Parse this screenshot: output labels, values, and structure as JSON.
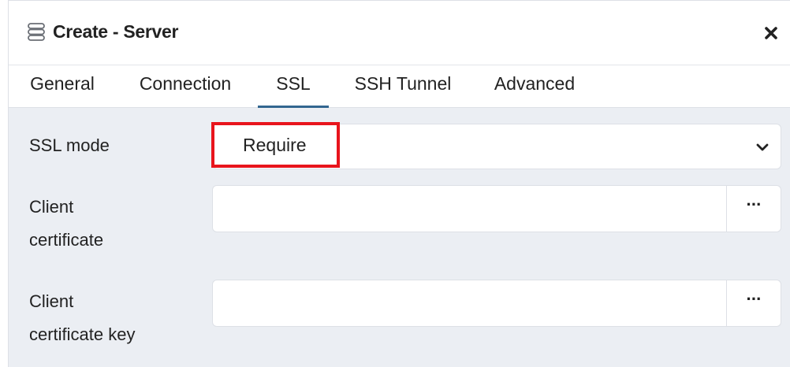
{
  "dialog": {
    "title": "Create - Server",
    "title_icon": "server-icon",
    "close_icon": "close-icon"
  },
  "tabs": [
    {
      "label": "General",
      "active": false
    },
    {
      "label": "Connection",
      "active": false
    },
    {
      "label": "SSL",
      "active": true
    },
    {
      "label": "SSH Tunnel",
      "active": false
    },
    {
      "label": "Advanced",
      "active": false
    }
  ],
  "form": {
    "ssl_mode": {
      "label": "SSL mode",
      "value": "Require",
      "icon": "chevron-down-icon"
    },
    "client_certificate": {
      "label_line1": "Client",
      "label_line2": "certificate",
      "value": "",
      "browse_label": "···"
    },
    "client_certificate_key": {
      "label_line1": "Client",
      "label_line2": "certificate key",
      "value": "",
      "browse_label": "···"
    }
  },
  "colors": {
    "active_tab_underline": "#326690",
    "content_background": "#ebeef3",
    "highlight_border": "#e8141c"
  }
}
